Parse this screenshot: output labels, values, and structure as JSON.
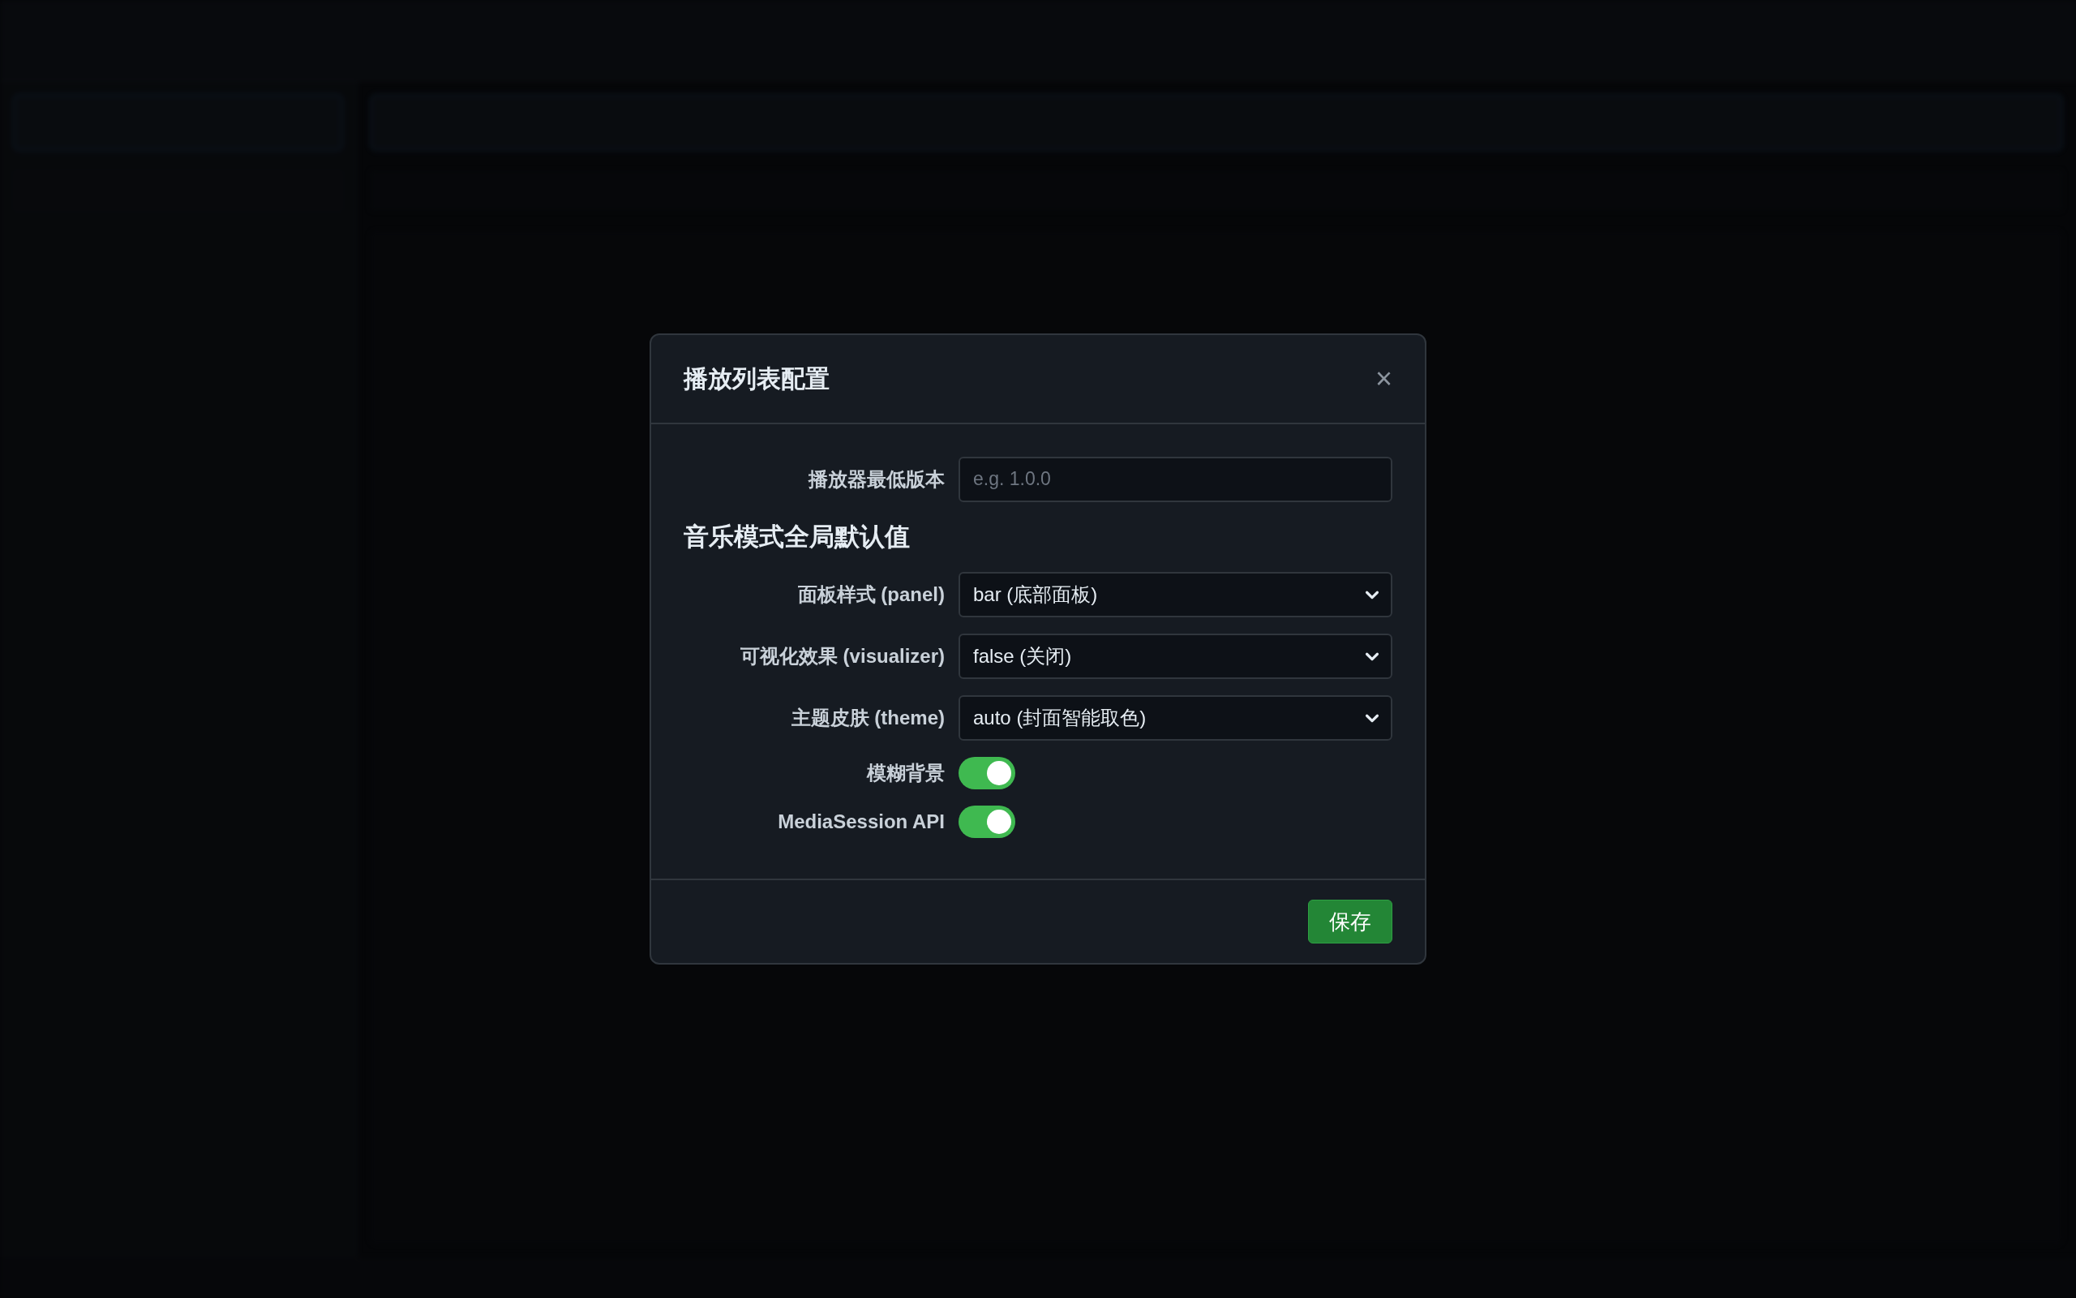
{
  "dialog": {
    "title": "播放列表配置",
    "close": "×",
    "fields": [
      {
        "kind": "text",
        "label": "播放器最低版本",
        "placeholder": "e.g. 1.0.0"
      }
    ],
    "section_title": "音乐模式全局默认值",
    "settings": [
      {
        "kind": "select",
        "label": "面板样式 (panel)",
        "value": "bar (底部面板)"
      },
      {
        "kind": "select",
        "label": "可视化效果 (visualizer)",
        "value": "false (关闭)"
      },
      {
        "kind": "select",
        "label": "主题皮肤 (theme)",
        "value": "auto (封面智能取色)"
      },
      {
        "kind": "toggle",
        "label": "模糊背景",
        "on": true
      },
      {
        "kind": "toggle",
        "label": "MediaSession API",
        "on": true
      }
    ],
    "save_button": "保存"
  }
}
